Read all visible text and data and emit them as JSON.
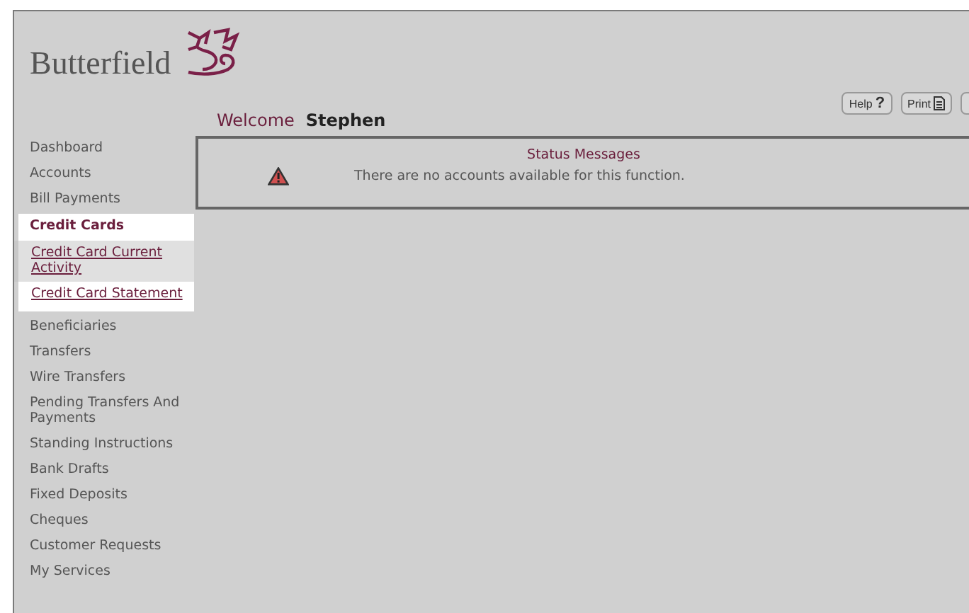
{
  "header": {
    "brand": "Butterfield",
    "buttons": [
      {
        "label": "Help",
        "glyph": "?",
        "kind": "help"
      },
      {
        "label": "Print",
        "kind": "print"
      },
      {
        "kind": "cutoff"
      }
    ]
  },
  "welcome": {
    "greeting": "Welcome",
    "name": "Stephen"
  },
  "sidebar": {
    "items": [
      {
        "label": "Dashboard"
      },
      {
        "label": "Accounts"
      },
      {
        "label": "Bill Payments"
      },
      {
        "label": "Credit Cards",
        "expanded": true,
        "children": [
          {
            "label": "Credit Card Current Activity",
            "selected": true
          },
          {
            "label": "Credit Card Statement",
            "selected": false
          }
        ]
      },
      {
        "label": "Beneficiaries"
      },
      {
        "label": "Transfers"
      },
      {
        "label": "Wire Transfers"
      },
      {
        "label": "Pending Transfers And Payments"
      },
      {
        "label": "Standing Instructions"
      },
      {
        "label": "Bank Drafts"
      },
      {
        "label": "Fixed Deposits"
      },
      {
        "label": "Cheques"
      },
      {
        "label": "Customer Requests"
      },
      {
        "label": "My Services"
      }
    ]
  },
  "status": {
    "title": "Status Messages",
    "message": "There are no accounts available for this function."
  }
}
